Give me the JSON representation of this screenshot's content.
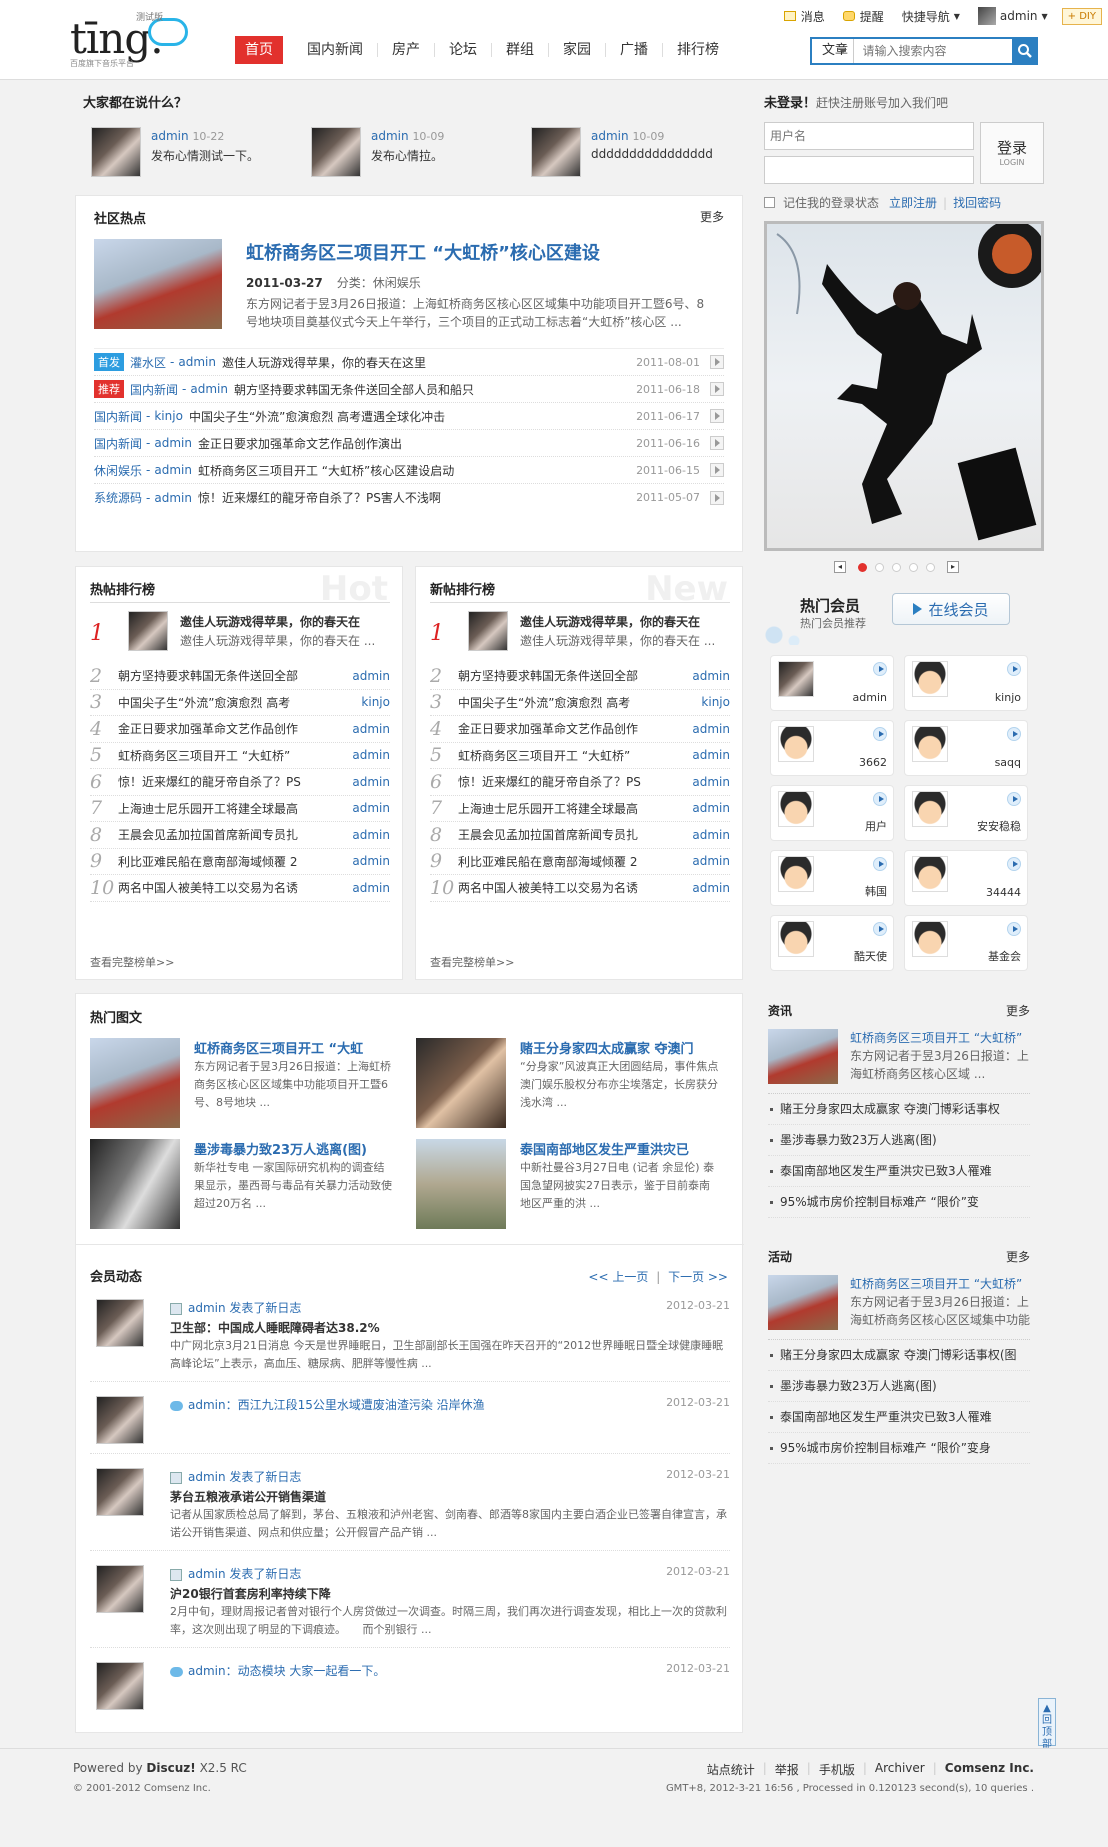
{
  "header": {
    "logo_text": "tīng.",
    "logo_sub": "百度旗下音乐平台",
    "logo_beta": "测试版",
    "nav": [
      "首页",
      "国内新闻",
      "房产",
      "论坛",
      "群组",
      "家园",
      "广播",
      "排行榜"
    ],
    "topbar": {
      "msg": "消息",
      "remind": "提醒",
      "quicknav": "快捷导航",
      "user": "admin",
      "diy": "+ DIY"
    },
    "search": {
      "category": "文章",
      "placeholder": "请输入搜索内容"
    }
  },
  "talk": {
    "title": "大家都在说什么？",
    "items": [
      {
        "user": "admin",
        "date": "10-22",
        "text": "发布心情测试一下。"
      },
      {
        "user": "admin",
        "date": "10-09",
        "text": "发布心情拉。"
      },
      {
        "user": "admin",
        "date": "10-09",
        "text": "dddddddddddddddd"
      }
    ]
  },
  "login": {
    "title": "未登录！",
    "hint": "赶快注册账号加入我们吧",
    "username_placeholder": "用户名",
    "password_placeholder": "",
    "login_btn": "登录",
    "login_btn_en": "LOGIN",
    "remember": "记住我的登录状态",
    "register": "立即注册",
    "findpw": "找回密码"
  },
  "hot": {
    "title": "社区热点",
    "more": "更多",
    "headline": "虹桥商务区三项目开工 “大虹桥”核心区建设",
    "date": "2011-03-27",
    "category": "分类：休闲娱乐",
    "summary": "东方网记者于昱3月26日报道：上海虹桥商务区核心区区域集中功能项目开工暨6号、8号地块项目奠基仪式今天上午举行，三个项目的正式动工标志着“大虹桥”核心区 ...",
    "list": [
      {
        "tag": "首发",
        "tagcolor": "#2d9de0",
        "cat": "灌水区",
        "user": "admin",
        "title": "邀佳人玩游戏得苹果，你的春天在这里",
        "date": "2011-08-01"
      },
      {
        "tag": "推荐",
        "tagcolor": "#e2312d",
        "cat": "国内新闻",
        "user": "admin",
        "title": "朝方坚持要求韩国无条件送回全部人员和船只",
        "date": "2011-06-18"
      },
      {
        "tag": "",
        "cat": "国内新闻",
        "user": "kinjo",
        "title": "中国尖子生“外流”愈演愈烈 高考遭遇全球化冲击",
        "date": "2011-06-17"
      },
      {
        "tag": "",
        "cat": "国内新闻",
        "user": "admin",
        "title": "金正日要求加强革命文艺作品创作演出",
        "date": "2011-06-16"
      },
      {
        "tag": "",
        "cat": "休闲娱乐",
        "user": "admin",
        "title": "虹桥商务区三项目开工 “大虹桥”核心区建设启动",
        "date": "2011-06-15"
      },
      {
        "tag": "",
        "cat": "系统源码",
        "user": "admin",
        "title": "惊！近来爆红的龍牙帝自杀了？PS害人不浅啊",
        "date": "2011-05-07"
      }
    ]
  },
  "rank_hot": {
    "title": "热帖排行榜",
    "watermark": "Hot",
    "top": {
      "title": "邀佳人玩游戏得苹果，你的春天在",
      "desc": "邀佳人玩游戏得苹果，你的春天在 ..."
    },
    "items": [
      {
        "n": "2",
        "t": "朝方坚持要求韩国无条件送回全部",
        "u": "admin"
      },
      {
        "n": "3",
        "t": "中国尖子生“外流”愈演愈烈 高考",
        "u": "kinjo"
      },
      {
        "n": "4",
        "t": "金正日要求加强革命文艺作品创作",
        "u": "admin"
      },
      {
        "n": "5",
        "t": "虹桥商务区三项目开工 “大虹桥”",
        "u": "admin"
      },
      {
        "n": "6",
        "t": "惊！近来爆红的龍牙帝自杀了？PS",
        "u": "admin"
      },
      {
        "n": "7",
        "t": "上海迪士尼乐园开工将建全球最高",
        "u": "admin"
      },
      {
        "n": "8",
        "t": "王晨会见孟加拉国首席新闻专员扎",
        "u": "admin"
      },
      {
        "n": "9",
        "t": "利比亚难民船在意南部海域倾覆 2",
        "u": "admin"
      },
      {
        "n": "10",
        "t": "两名中国人被美特工以交易为名诱",
        "u": "admin"
      }
    ],
    "all": "查看完整榜单>>"
  },
  "rank_new": {
    "title": "新帖排行榜",
    "watermark": "New",
    "top": {
      "title": "邀佳人玩游戏得苹果，你的春天在",
      "desc": "邀佳人玩游戏得苹果，你的春天在 ..."
    },
    "items": [
      {
        "n": "2",
        "t": "朝方坚持要求韩国无条件送回全部",
        "u": "admin"
      },
      {
        "n": "3",
        "t": "中国尖子生“外流”愈演愈烈 高考",
        "u": "kinjo"
      },
      {
        "n": "4",
        "t": "金正日要求加强革命文艺作品创作",
        "u": "admin"
      },
      {
        "n": "5",
        "t": "虹桥商务区三项目开工 “大虹桥”",
        "u": "admin"
      },
      {
        "n": "6",
        "t": "惊！近来爆红的龍牙帝自杀了？PS",
        "u": "admin"
      },
      {
        "n": "7",
        "t": "上海迪士尼乐园开工将建全球最高",
        "u": "admin"
      },
      {
        "n": "8",
        "t": "王晨会见孟加拉国首席新闻专员扎",
        "u": "admin"
      },
      {
        "n": "9",
        "t": "利比亚难民船在意南部海域倾覆 2",
        "u": "admin"
      },
      {
        "n": "10",
        "t": "两名中国人被美特工以交易为名诱",
        "u": "admin"
      }
    ],
    "all": "查看完整榜单>>"
  },
  "pics": {
    "title": "热门图文",
    "items": [
      {
        "title": "虹桥商务区三项目开工 “大虹",
        "desc": "东方网记者于昱3月26日报道：上海虹桥商务区核心区区域集中功能项目开工暨6号、8号地块 ..."
      },
      {
        "title": "赌王分身家四太成赢家 夺澳门",
        "desc": "“分身家”风波真正大团圆结局，事件焦点澳门娱乐股权分布亦尘埃落定，长房获分浅水湾 ..."
      },
      {
        "title": "墨涉毒暴力致23万人逃离(图)",
        "desc": "新华社专电 一家国际研究机构的调查结果显示，墨西哥与毒品有关暴力活动致使超过20万名 ..."
      },
      {
        "title": "泰国南部地区发生严重洪灾已",
        "desc": "中新社曼谷3月27日电 (记者 余显伦) 泰国急望网披实27日表示，鉴于目前泰南地区严重的洪 ..."
      }
    ]
  },
  "feed": {
    "title": "会员动态",
    "prev": "<< 上一页",
    "next": "下一页 >>",
    "items": [
      {
        "type": "blog",
        "head": "admin 发表了新日志",
        "title": "卫生部：中国成人睡眠障碍者达38.2%",
        "desc": "中广网北京3月21日消息 今天是世界睡眠日，卫生部副部长王国强在昨天召开的“2012世界睡眠日暨全球健康睡眠高峰论坛”上表示，高血压、糖尿病、肥胖等慢性病 ...",
        "date": "2012-03-21"
      },
      {
        "type": "say",
        "head": "admin：西江九江段15公里水域遭废油渣污染 沿岸休渔",
        "title": "",
        "desc": "",
        "date": "2012-03-21"
      },
      {
        "type": "blog",
        "head": "admin 发表了新日志",
        "title": "茅台五粮液承诺公开销售渠道",
        "desc": "记者从国家质检总局了解到，茅台、五粮液和泸州老窖、剑南春、郎酒等8家国内主要白酒企业已签署自律宣言，承诺公开销售渠道、网点和供应量；公开假冒产品产销 ...",
        "date": "2012-03-21"
      },
      {
        "type": "blog",
        "head": "admin 发表了新日志",
        "title": "沪20银行首套房利率持续下降",
        "desc": "2月中旬，理财周报记者曾对银行个人房贷做过一次调查。时隔三周，我们再次进行调查发现，相比上一次的贷款利率，这次则出现了明显的下调痕迹。　　而个别银行 ...",
        "date": "2012-03-21"
      },
      {
        "type": "say",
        "head": "admin：动态模块 大家一起看一下。",
        "title": "",
        "desc": "",
        "date": "2012-03-21"
      }
    ]
  },
  "members": {
    "title": "热门会员",
    "subtitle": "热门会员推荐",
    "online_btn": "在线会员",
    "list": [
      "admin",
      "kinjo",
      "3662",
      "saqq",
      "用户",
      "安安稳稳",
      "韩国",
      "34444",
      "酷天使",
      "基金会"
    ]
  },
  "news": {
    "title": "资讯",
    "more": "更多",
    "headline": "虹桥商务区三项目开工 “大虹桥”",
    "summary": "东方网记者于昱3月26日报道：上海虹桥商务区核心区域 ...",
    "list": [
      "赌王分身家四太成赢家 夺澳门博彩话事权",
      "墨涉毒暴力致23万人逃离(图)",
      "泰国南部地区发生严重洪灾已致3人罹难",
      "95%城市房价控制目标难产 “限价”变"
    ]
  },
  "activity": {
    "title": "活动",
    "more": "更多",
    "headline": "虹桥商务区三项目开工 “大虹桥”",
    "summary": "东方网记者于昱3月26日报道：上海虹桥商务区核心区区域集中功能",
    "list": [
      "赌王分身家四太成赢家 夺澳门博彩话事权(图",
      "墨涉毒暴力致23万人逃离(图)",
      "泰国南部地区发生严重洪灾已致3人罹难",
      "95%城市房价控制目标难产 “限价”变身"
    ]
  },
  "backtop": "回顶部",
  "footer": {
    "powered": "Powered by",
    "brand": "Discuz!",
    "version": "X2.5 RC",
    "copy": "© 2001-2012 Comsenz Inc.",
    "links": [
      "站点统计",
      "举报",
      "手机版",
      "Archiver"
    ],
    "company": "Comsenz Inc.",
    "stat": "GMT+8, 2012-3-21 16:56 , Processed in 0.120123 second(s), 10 queries ."
  }
}
